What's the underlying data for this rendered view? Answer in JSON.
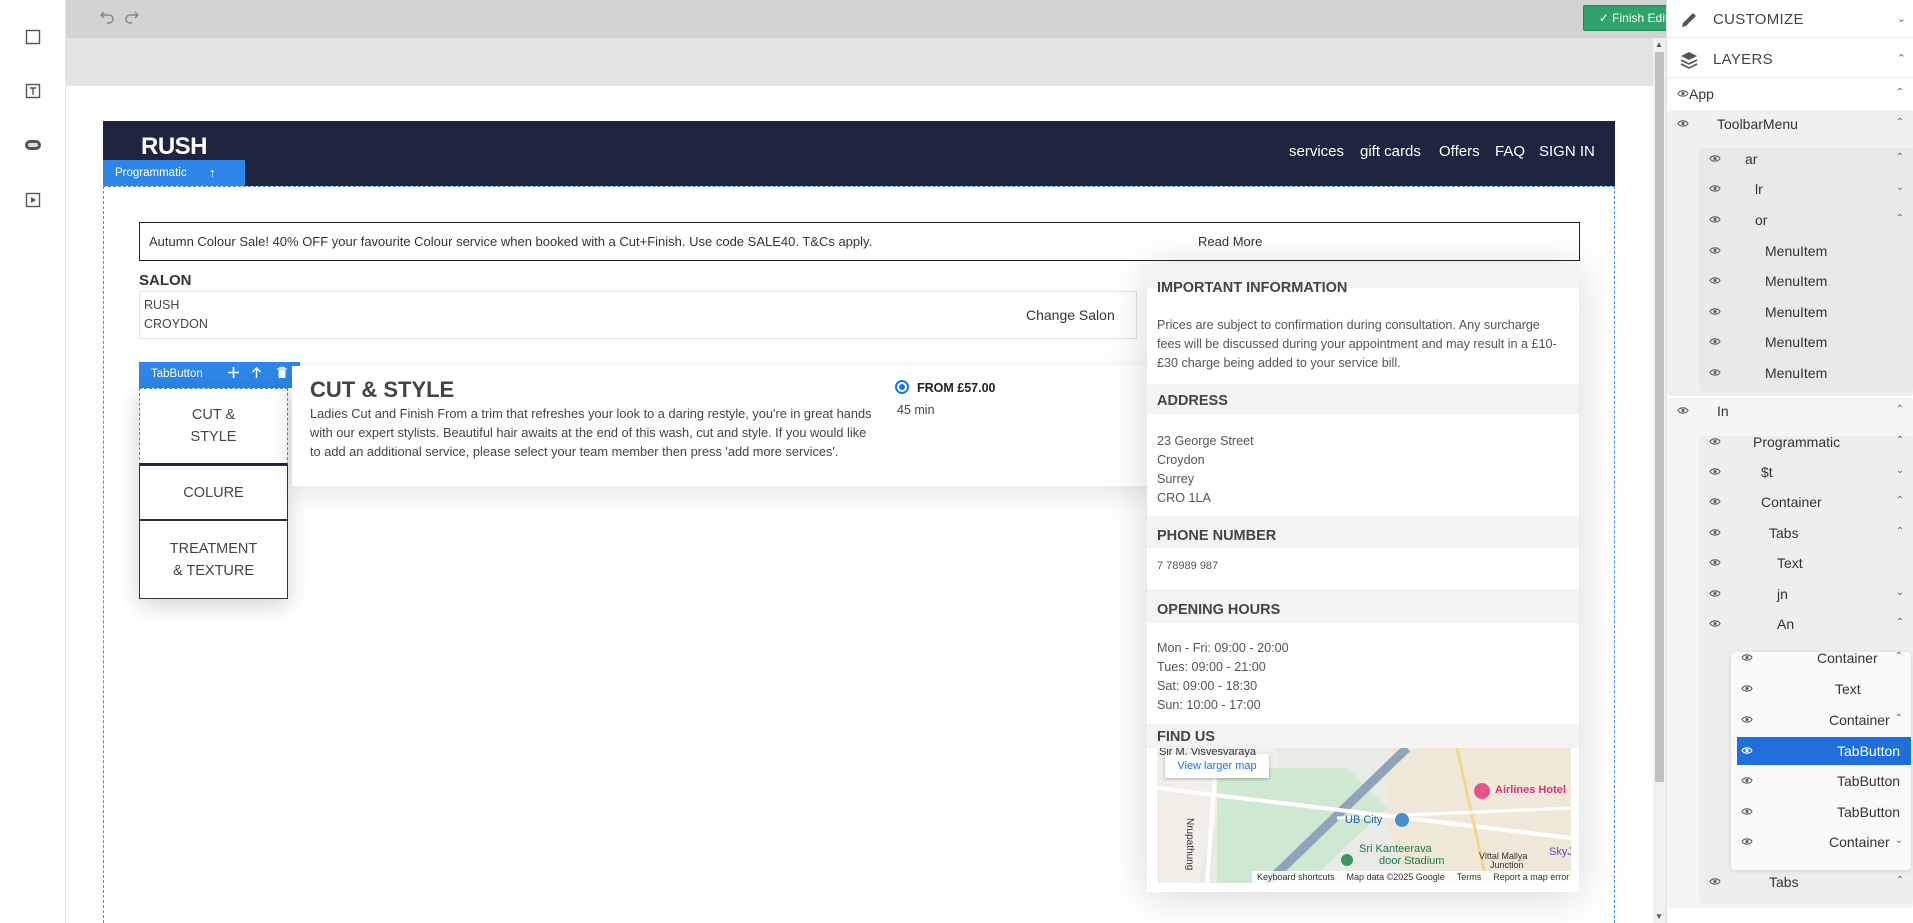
{
  "editor": {
    "finish_label": "✓ Finish Editing",
    "undo_icon": "undo-icon",
    "redo_icon": "redo-icon"
  },
  "rail": {
    "tools": [
      "container-tool-icon",
      "text-tool-icon",
      "button-tool-icon",
      "video-tool-icon"
    ]
  },
  "site": {
    "logo": "RUSH",
    "nav": [
      "services",
      "gift cards",
      "Offers",
      "FAQ",
      "SIGN IN"
    ],
    "selection_tag": "Programmatic",
    "banner": {
      "text": "Autumn Colour Sale! 40% OFF your favourite Colour service when booked with a Cut+Finish. Use code SALE40. T&Cs apply.",
      "read_more": "Read More"
    },
    "salon": {
      "title": "SALON",
      "line1": "RUSH",
      "line2": "CROYDON",
      "change": "Change Salon"
    },
    "tab_tag": "TabButton",
    "tabs": [
      {
        "line1": "CUT &",
        "line2": "STYLE"
      },
      {
        "line1": "COLURE",
        "line2": ""
      },
      {
        "line1": "TREATMENT",
        "line2": "& TEXTURE"
      }
    ],
    "service": {
      "title": "CUT & STYLE",
      "description": "Ladies Cut and Finish From a trim that refreshes your look to a daring restyle, you're in great hands with our expert stylists. Beautiful hair awaits at the end of this wash, cut and style. If you would like to add an additional service, please select your team member then press 'add more services'.",
      "price": "FROM £57.00",
      "duration": "45 min"
    },
    "info": {
      "important_title": "IMPORTANT INFORMATION",
      "important_text": "Prices are subject to confirmation during consultation. Any surcharge fees will be discussed during your appointment and may result in a £10-£30 charge being added to your service bill.",
      "address_title": "ADDRESS",
      "address": [
        "23 George Street",
        "Croydon",
        "Surrey",
        "CRO 1LA"
      ],
      "phone_title": "PHONE NUMBER",
      "phone": "7 78989 987",
      "hours_title": "OPENING HOURS",
      "hours": [
        "Mon - Fri: 09:00 - 20:00",
        "Tues: 09:00 - 21:00",
        "Sat: 09:00 - 18:30",
        "Sun: 10:00 - 17:00"
      ],
      "find_title": "FIND US",
      "map": {
        "view_larger": "View larger map",
        "labels": [
          "Sir M. Visvesvaraya",
          "Airlines Hotel",
          "UB City",
          "Sri Kanteerava",
          "door Stadium",
          "Nrupathung",
          "Vittal Mallya",
          "Junction",
          "SkyJ"
        ],
        "footer": [
          "Keyboard shortcuts",
          "Map data ©2025 Google",
          "Terms",
          "Report a map error"
        ]
      }
    }
  },
  "panel": {
    "customize": "CUSTOMIZE",
    "layers": "LAYERS",
    "tree": [
      {
        "label": "App",
        "chev": "up"
      },
      {
        "label": "ToolbarMenu",
        "chev": "up"
      },
      {
        "label": "ar",
        "chev": "up"
      },
      {
        "label": "lr",
        "chev": "down"
      },
      {
        "label": "or",
        "chev": "up"
      },
      {
        "label": "MenuItem",
        "chev": ""
      },
      {
        "label": "MenuItem",
        "chev": ""
      },
      {
        "label": "MenuItem",
        "chev": ""
      },
      {
        "label": "MenuItem",
        "chev": ""
      },
      {
        "label": "MenuItem",
        "chev": ""
      },
      {
        "label": "In",
        "chev": "up"
      },
      {
        "label": "Programmatic",
        "chev": "up"
      },
      {
        "label": "$t",
        "chev": "down"
      },
      {
        "label": "Container",
        "chev": "up"
      },
      {
        "label": "Tabs",
        "chev": "up"
      },
      {
        "label": "Text",
        "chev": ""
      },
      {
        "label": "jn",
        "chev": "down"
      },
      {
        "label": "An",
        "chev": "up"
      },
      {
        "label": "Container",
        "chev": "up"
      },
      {
        "label": "Text",
        "chev": ""
      },
      {
        "label": "Container",
        "chev": "up"
      },
      {
        "label": "TabButton",
        "chev": ""
      },
      {
        "label": "TabButton",
        "chev": ""
      },
      {
        "label": "TabButton",
        "chev": ""
      },
      {
        "label": "Container",
        "chev": "down"
      },
      {
        "label": "Tabs",
        "chev": "up"
      }
    ],
    "selected_index": 21
  }
}
